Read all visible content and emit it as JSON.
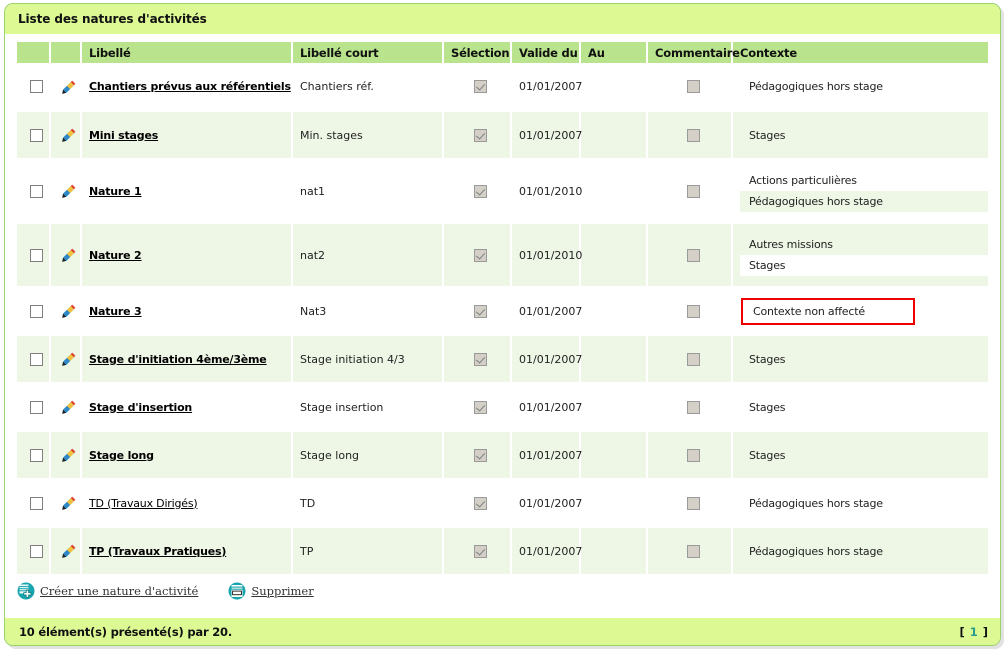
{
  "window": {
    "title": "Liste des natures d'activités"
  },
  "table": {
    "columns": [
      {
        "key": "check",
        "label": ""
      },
      {
        "key": "edit",
        "label": ""
      },
      {
        "key": "libelle",
        "label": "Libellé"
      },
      {
        "key": "court",
        "label": "Libellé court"
      },
      {
        "key": "sel",
        "label": "Sélection"
      },
      {
        "key": "du",
        "label": "Valide du"
      },
      {
        "key": "au",
        "label": "Au"
      },
      {
        "key": "com",
        "label": "Commentaire"
      },
      {
        "key": "ctx",
        "label": "Contexte"
      }
    ],
    "rows": [
      {
        "checked": false,
        "edit_icon": "pencil-icon",
        "libelle": "Chantiers prévus aux référentiels",
        "libelle_visited": false,
        "libelle_court": "Chantiers réf.",
        "selection_checked": true,
        "valide_du": "01/01/2007",
        "au": "",
        "commentaire_checked": false,
        "contextes": [
          "Pédagogiques hors stage"
        ],
        "contexte_boxed": false
      },
      {
        "checked": false,
        "edit_icon": "pencil-icon",
        "libelle": "Mini stages",
        "libelle_visited": false,
        "libelle_court": "Min. stages",
        "selection_checked": true,
        "valide_du": "01/01/2007",
        "au": "",
        "commentaire_checked": false,
        "contextes": [
          "Stages"
        ],
        "contexte_boxed": false
      },
      {
        "checked": false,
        "edit_icon": "pencil-icon",
        "libelle": "Nature 1",
        "libelle_visited": false,
        "libelle_court": "nat1",
        "selection_checked": true,
        "valide_du": "01/01/2010",
        "au": "",
        "commentaire_checked": false,
        "contextes": [
          "Actions particulières",
          "Pédagogiques hors stage"
        ],
        "contexte_boxed": false
      },
      {
        "checked": false,
        "edit_icon": "pencil-icon",
        "libelle": "Nature 2",
        "libelle_visited": false,
        "libelle_court": "nat2",
        "selection_checked": true,
        "valide_du": "01/01/2010",
        "au": "",
        "commentaire_checked": false,
        "contextes": [
          "Autres missions",
          "Stages"
        ],
        "contexte_boxed": false
      },
      {
        "checked": false,
        "edit_icon": "pencil-icon",
        "libelle": "Nature 3",
        "libelle_visited": false,
        "libelle_court": "Nat3",
        "selection_checked": true,
        "valide_du": "01/01/2007",
        "au": "",
        "commentaire_checked": false,
        "contextes": [
          "Contexte non affecté"
        ],
        "contexte_boxed": true
      },
      {
        "checked": false,
        "edit_icon": "pencil-icon",
        "libelle": "Stage d'initiation 4ème/3ème",
        "libelle_visited": false,
        "libelle_court": "Stage initiation 4/3",
        "selection_checked": true,
        "valide_du": "01/01/2007",
        "au": "",
        "commentaire_checked": false,
        "contextes": [
          "Stages"
        ],
        "contexte_boxed": false
      },
      {
        "checked": false,
        "edit_icon": "pencil-icon",
        "libelle": "Stage d'insertion",
        "libelle_visited": false,
        "libelle_court": "Stage insertion",
        "selection_checked": true,
        "valide_du": "01/01/2007",
        "au": "",
        "commentaire_checked": false,
        "contextes": [
          "Stages"
        ],
        "contexte_boxed": false
      },
      {
        "checked": false,
        "edit_icon": "pencil-icon",
        "libelle": "Stage long",
        "libelle_visited": false,
        "libelle_court": "Stage long",
        "selection_checked": true,
        "valide_du": "01/01/2007",
        "au": "",
        "commentaire_checked": false,
        "contextes": [
          "Stages"
        ],
        "contexte_boxed": false
      },
      {
        "checked": false,
        "edit_icon": "pencil-icon",
        "libelle": "TD (Travaux Dirigés)",
        "libelle_visited": true,
        "libelle_court": "TD",
        "selection_checked": true,
        "valide_du": "01/01/2007",
        "au": "",
        "commentaire_checked": false,
        "contextes": [
          "Pédagogiques hors stage"
        ],
        "contexte_boxed": false
      },
      {
        "checked": false,
        "edit_icon": "pencil-icon",
        "libelle": "TP (Travaux Pratiques)",
        "libelle_visited": false,
        "libelle_court": "TP",
        "selection_checked": true,
        "valide_du": "01/01/2007",
        "au": "",
        "commentaire_checked": false,
        "contextes": [
          "Pédagogiques hors stage"
        ],
        "contexte_boxed": false
      }
    ]
  },
  "actions": [
    {
      "icon": "add-circle-icon",
      "label": "Créer une nature d'activité"
    },
    {
      "icon": "delete-list-icon",
      "label": "Supprimer"
    }
  ],
  "status": {
    "text": "10 élément(s) présenté(s) par 20.",
    "pager_open": "[",
    "pager_page": "1",
    "pager_close": "]"
  },
  "colors": {
    "title_bar": "#ddf994",
    "header_cell": "#b9e48d",
    "row_alt": "#eef7e6",
    "border": "#9ad36a",
    "alert_box": "#ee0000",
    "icon_teal": "#1fa8a8",
    "pager_num": "#2a9d8f"
  }
}
